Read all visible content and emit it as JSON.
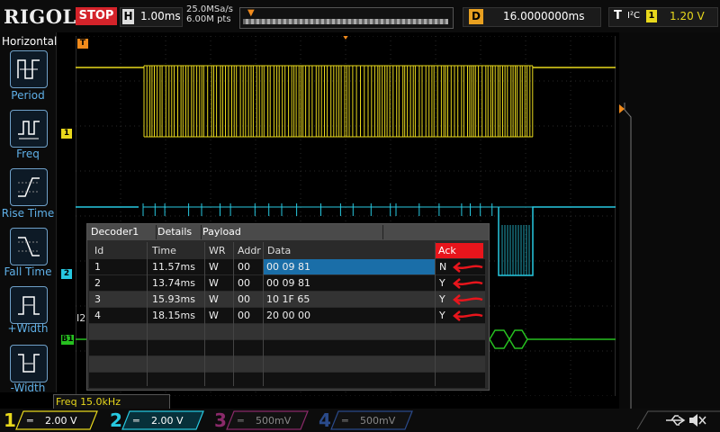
{
  "brand": "RIGOL",
  "run_state": "STOP",
  "horizontal": {
    "key": "H",
    "timebase": "1.00ms"
  },
  "sample": {
    "rate": "25.0MSa/s",
    "points": "6.00M pts"
  },
  "delay": {
    "key": "D",
    "value": "16.0000000ms"
  },
  "trigger": {
    "key": "T",
    "protocol": "I²C",
    "channel": "1",
    "level": "1.20 V"
  },
  "side_menu": {
    "title": "Horizontal",
    "items": [
      {
        "label": "Period"
      },
      {
        "label": "Freq"
      },
      {
        "label": "Rise Time"
      },
      {
        "label": "Fall Time"
      },
      {
        "label": "+Width"
      },
      {
        "label": "-Width"
      }
    ]
  },
  "markers": {
    "trigger": "T",
    "ch1": "1",
    "ch2": "2",
    "bus": "B1",
    "i2": "I2"
  },
  "decoder": {
    "tabs": [
      "Decoder1",
      "Details",
      "Payload"
    ],
    "columns": [
      "Id",
      "Time",
      "WR",
      "Addr",
      "Data",
      "Ack"
    ],
    "rows": [
      {
        "id": "1",
        "time": "11.57ms",
        "wr": "W",
        "addr": "00",
        "data": "00 09 81",
        "ack": "N"
      },
      {
        "id": "2",
        "time": "13.74ms",
        "wr": "W",
        "addr": "00",
        "data": "00 09 81",
        "ack": "Y"
      },
      {
        "id": "3",
        "time": "15.93ms",
        "wr": "W",
        "addr": "00",
        "data": "10 1F 65",
        "ack": "Y"
      },
      {
        "id": "4",
        "time": "18.15ms",
        "wr": "W",
        "addr": "00",
        "data": "20 00 00",
        "ack": "Y"
      }
    ]
  },
  "measurement": {
    "label": "Freq",
    "value": "15.0kHz"
  },
  "channels": [
    {
      "num": "1",
      "scale": "2.00 V",
      "color": "#e8d81c",
      "active": true
    },
    {
      "num": "2",
      "scale": "2.00 V",
      "color": "#27c8e0",
      "active": true
    },
    {
      "num": "3",
      "scale": "500mV",
      "color": "#8a2a6a",
      "active": false
    },
    {
      "num": "4",
      "scale": "500mV",
      "color": "#2a4a8a",
      "active": false
    }
  ],
  "colors": {
    "ch1": "#e8d81c",
    "ch2": "#27c8e0",
    "bus": "#27c020",
    "selected_row": "#1a6ea8",
    "ack_header": "#e8151c",
    "arrow": "#e8151c"
  },
  "icons": [
    "usb-icon",
    "mute-icon"
  ]
}
